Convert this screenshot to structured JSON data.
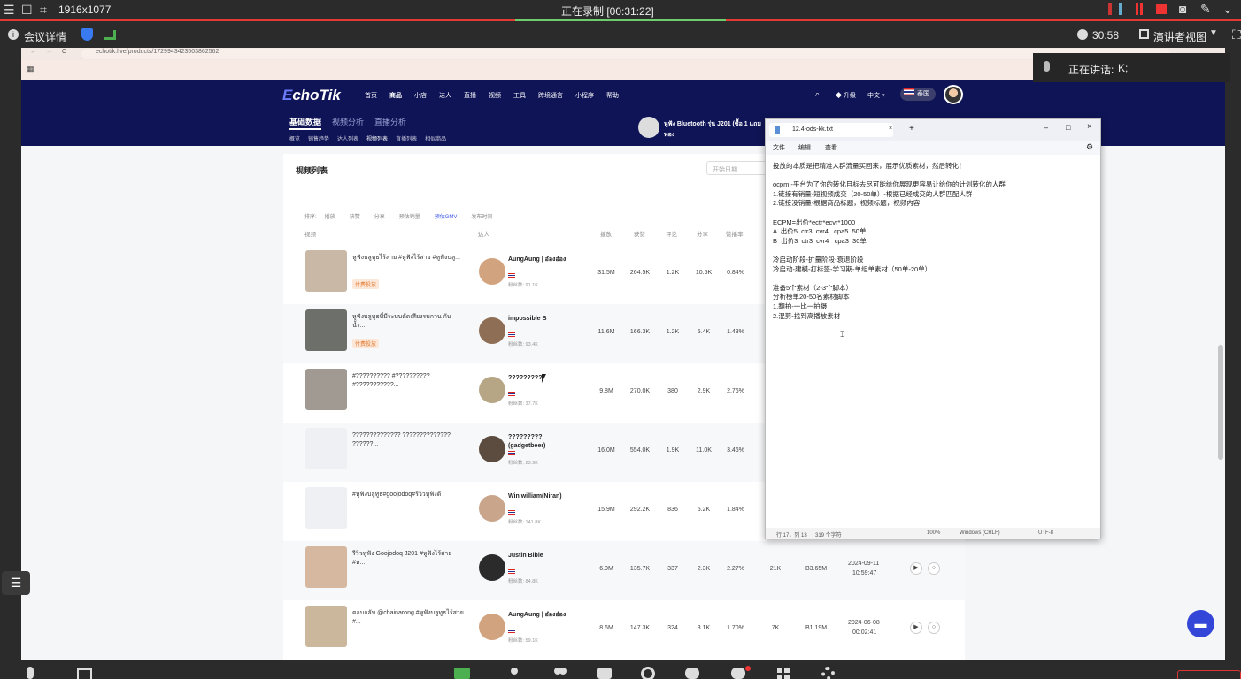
{
  "meeting": {
    "resolution": "1916x1077",
    "recording": "正在录制 [00:31:22]",
    "info_label": "会议详情",
    "timer": "30:58",
    "presenter_view": "演讲者视图",
    "speaking": "正在讲话:",
    "speaker": "K;"
  },
  "browser": {
    "url": "echotik.live/products/1729943423503862562"
  },
  "echotik": {
    "logo": "EchoTik",
    "nav": [
      "首页",
      "商品",
      "小店",
      "达人",
      "直播",
      "视频",
      "工具",
      "跨境通言",
      "小程序",
      "帮助"
    ],
    "upgrade": "升级",
    "lang": "中文",
    "country": "泰国",
    "subtabs": [
      "基础数据",
      "视频分析",
      "直播分析"
    ],
    "subnav": [
      "概览",
      "销售趋势",
      "达人列表",
      "视频列表",
      "直播列表",
      "相似商品"
    ],
    "product_title": "หูฟัง Bluetooth รุ่น J201 (ซื้อ 1 แถม",
    "product_sub": "ทอง"
  },
  "video_list": {
    "title": "视频列表",
    "date_placeholder": "开始日期",
    "sort_label": "排序:",
    "sort_options": [
      "播放",
      "获赞",
      "分享",
      "预估销量",
      "预估GMV",
      "发布时间"
    ],
    "headers": {
      "video": "视频",
      "creator": "达人",
      "views": "播放",
      "likes": "获赞",
      "comments": "评论",
      "shares": "分享",
      "rate": "赞播率"
    },
    "rows": [
      {
        "title": "หูฟังบลูทูธไร้สาย #หูฟังไร้สาย #หูฟังบลู...",
        "tag": "付费投放",
        "creator": "AungAung | อ๋องอ๋อง",
        "fans": "粉丝数: 91.1K",
        "views": "31.5M",
        "likes": "264.5K",
        "comments": "1.2K",
        "shares": "10.5K",
        "rate": "0.84%",
        "extra": "",
        "gmv": "",
        "time1": "",
        "time2": ""
      },
      {
        "title": "หูฟังบลูทูธที่มีระบบตัดเสียงรบกวน กันน้ำ...",
        "tag": "付费投放",
        "creator": "impossible B",
        "fans": "粉丝数: 93.4K",
        "views": "11.6M",
        "likes": "166.3K",
        "comments": "1.2K",
        "shares": "5.4K",
        "rate": "1.43%",
        "extra": "",
        "gmv": "",
        "time1": "",
        "time2": ""
      },
      {
        "title": "#?????????? #?????????? #???????????...",
        "tag": "",
        "creator": "?????????",
        "fans": "粉丝数: 37.7K",
        "views": "9.8M",
        "likes": "270.0K",
        "comments": "380",
        "shares": "2.9K",
        "rate": "2.76%",
        "extra": "",
        "gmv": "",
        "time1": "",
        "time2": ""
      },
      {
        "title": "?????????????? ?????????????? ??????...",
        "tag": "",
        "creator": "????????? (gadgetbeer)",
        "fans": "粉丝数: 23.9K",
        "views": "16.0M",
        "likes": "554.0K",
        "comments": "1.9K",
        "shares": "11.0K",
        "rate": "3.46%",
        "extra": "",
        "gmv": "",
        "time1": "",
        "time2": ""
      },
      {
        "title": "#หูฟังบลูทูธ#goojodoq#รีวิวหูฟังดี",
        "tag": "",
        "creator": "Win william(Niran)",
        "fans": "粉丝数: 141.8K",
        "views": "15.9M",
        "likes": "292.2K",
        "comments": "836",
        "shares": "5.2K",
        "rate": "1.84%",
        "extra": "",
        "gmv": "",
        "time1": "",
        "time2": ""
      },
      {
        "title": "รีวิวหูฟัง Goojodoq J201 #หูฟังไร้สาย #ห...",
        "tag": "",
        "creator": "Justin Bible",
        "fans": "粉丝数: 84.8K",
        "views": "6.0M",
        "likes": "135.7K",
        "comments": "337",
        "shares": "2.3K",
        "rate": "2.27%",
        "extra": "21K",
        "gmv": "B3.65M",
        "time1": "2024-09-11",
        "time2": "10:59:47"
      },
      {
        "title": "ตอบกลับ @chainarong #หูฟังบลูทูธไร้สาย #...",
        "tag": "",
        "creator": "AungAung | อ๋องอ๋อง",
        "fans": "粉丝数: 59.1K",
        "views": "8.6M",
        "likes": "147.3K",
        "comments": "324",
        "shares": "3.1K",
        "rate": "1.70%",
        "extra": "7K",
        "gmv": "B1.19M",
        "time1": "2024-06-08",
        "time2": "00:02:41"
      }
    ]
  },
  "notepad": {
    "tab": "12.4-ods-kk.txt",
    "menu": [
      "文件",
      "编辑",
      "查看"
    ],
    "lines": [
      "投放的本质是把精准人群流量买回来，展示优质素材，然后转化！",
      "",
      "ocpm -平台为了你的转化目标去尽可能给你展现更容易让给你的计划转化的人群",
      "1.链接有销量-短视频成交（20-50单）-根据已经成交的人群匹配人群",
      "2.链接没销量-根据商品标题，视频标题，视频内容",
      "",
      "ECPM=出价*ectr*ecvr*1000",
      "A  出价5  ctr3  cvr4   cpa5  50单",
      "B  出价3  ctr3  cvr4   cpa3  30单",
      "",
      "冷启动阶段-扩量阶段-衰退阶段",
      "冷启动-建模-打标签-学习期-单组单素材（50单-20单）",
      "",
      "准备5个素材（2-3个脚本）",
      "分析榜单20-50名素材脚本",
      "1.翻拍-一比一拍摄",
      "2.混剪-找到高播放素材"
    ],
    "status": {
      "pos": "行 17，列 13",
      "chars": "319 个字符",
      "zoom": "100%",
      "eol": "Windows (CRLF)",
      "enc": "UTF-8"
    }
  }
}
